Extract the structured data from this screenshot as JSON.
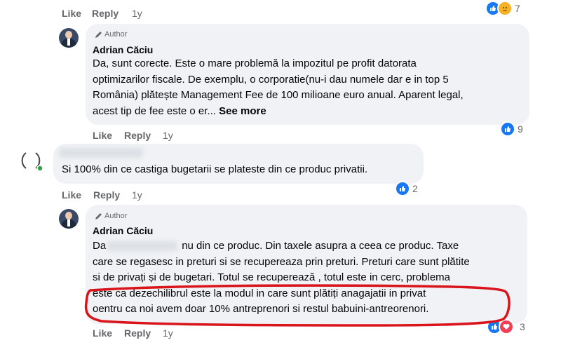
{
  "top_actions": {
    "like": "Like",
    "reply": "Reply",
    "time": "1y"
  },
  "top_reaction": {
    "count": "7",
    "types": [
      "like-icon",
      "sad-icon"
    ]
  },
  "comment1": {
    "author_tag": "Author",
    "name": "Adrian Căciu",
    "text_lines": [
      "Da, sunt corecte. Este o mare problemă la impozitul pe profit datorata",
      "optimizarilor fiscale. De exemplu, o corporatie(nu-i dau numele dar e in top 5",
      "România) plătește Management Fee de 100 milioane euro anual. Aparent legal,",
      "acest tip de fee este o er..."
    ],
    "see_more": "See more",
    "actions": {
      "like": "Like",
      "reply": "Reply",
      "time": "1y"
    },
    "reaction_count": "9"
  },
  "comment2": {
    "text": "Si 100% din ce castiga bugetarii se plateste din ce produc privatii.",
    "actions": {
      "like": "Like",
      "reply": "Reply",
      "time": "1y"
    },
    "reaction_count": "2"
  },
  "comment3": {
    "author_tag": "Author",
    "name": "Adrian Căciu",
    "line1_start": "Da",
    "line1_end": "nu din ce produc. Din taxele asupra a ceea ce produc. Taxe",
    "text_lines": [
      "care se regasesc in preturi si se recupereaza prin preturi. Preturi care sunt plătite",
      "si de privați și de bugetari. Totul se recuperează , totul este in cerc, problema",
      "este ca dezechilibrul este la modul in care sunt plătiți anagajatii in privat",
      "oentru ca noi avem doar 10% antreprenori si restul babuini-antreorenori."
    ],
    "actions": {
      "like": "Like",
      "reply": "Reply",
      "time": "1y"
    },
    "reaction_count": "3"
  },
  "colors": {
    "highlight_ring": "#d9151b",
    "like_blue": "#1877f2",
    "heart_red": "#f33e58"
  }
}
